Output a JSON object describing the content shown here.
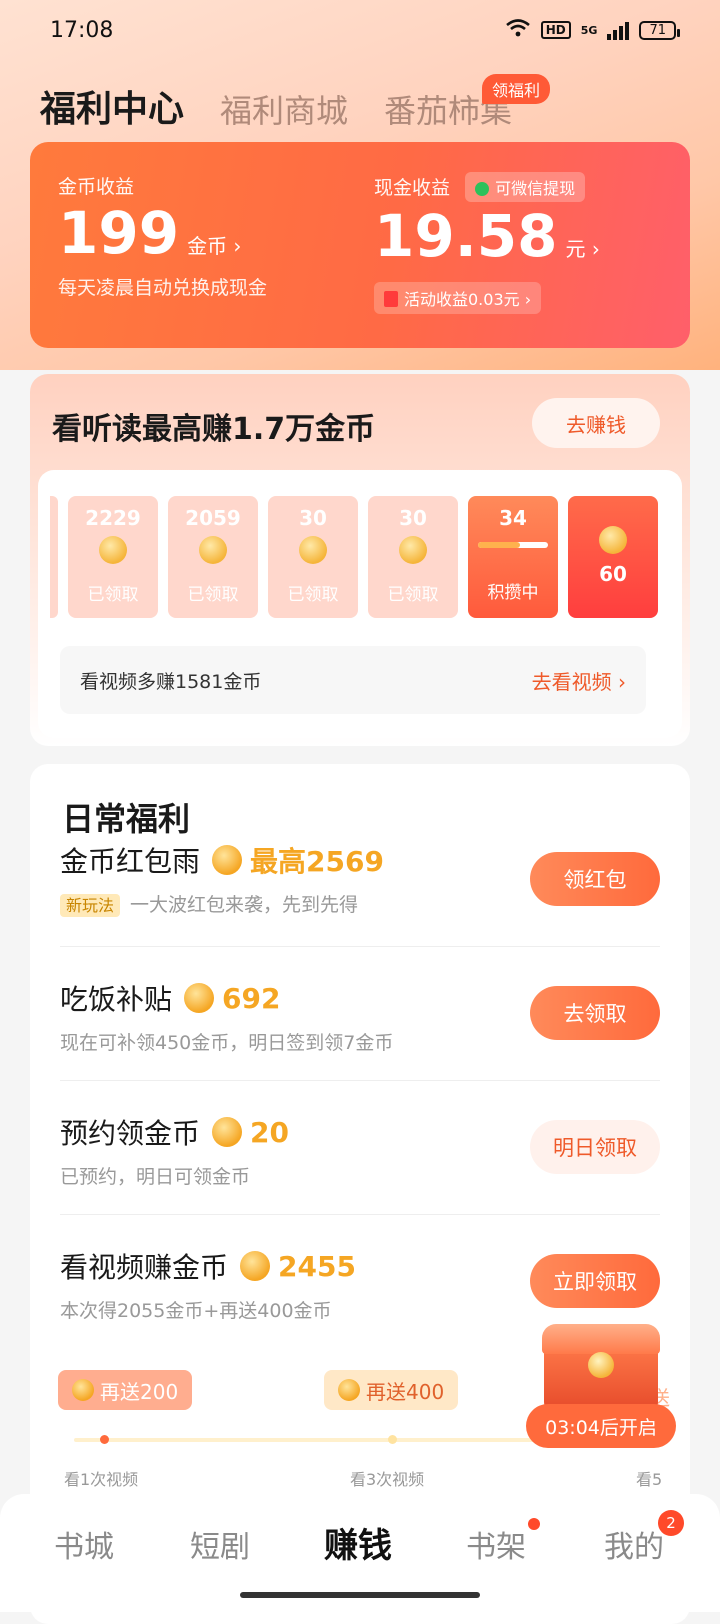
{
  "status": {
    "time": "17:08",
    "network": "5G",
    "battery": "71"
  },
  "tabs": [
    {
      "label": "福利中心"
    },
    {
      "label": "福利商城"
    },
    {
      "label": "番茄柿集"
    }
  ],
  "tab_badge": "领福利",
  "earnings": {
    "coin_label": "金币收益",
    "coin_value": "199",
    "coin_unit": "金币 ›",
    "coin_note": "每天凌晨自动兑换成现金",
    "cash_label": "现金收益",
    "cash_value": "19.58",
    "cash_unit": "元 ›",
    "wechat_pill": "可微信提现",
    "activity_pill": "活动收益0.03元 ›"
  },
  "watch": {
    "title": "看听读最高赚1.7万金币",
    "button": "去赚钱",
    "slots": [
      {
        "amount": "2229",
        "status": "已领取"
      },
      {
        "amount": "2059",
        "status": "已领取"
      },
      {
        "amount": "30",
        "status": "已领取"
      },
      {
        "amount": "30",
        "status": "已领取"
      },
      {
        "amount": "34",
        "status": "积攒中",
        "progress": 0.6
      },
      {
        "amount": "60"
      }
    ],
    "video_text": "看视频多赚1581金币",
    "video_link": "去看视频 ›"
  },
  "daily": {
    "title": "日常福利",
    "tasks": [
      {
        "name": "金币红包雨",
        "value": "最高2569",
        "tag": "新玩法",
        "desc": "一大波红包来袭，先到先得",
        "button": "领红包"
      },
      {
        "name": "吃饭补贴",
        "value": "692",
        "desc": "现在可补领450金币，明日签到领7金币",
        "button": "去领取"
      },
      {
        "name": "预约领金币",
        "value": "20",
        "desc": "已预约，明日可领金币",
        "button": "明日领取"
      },
      {
        "name": "看视频赚金币",
        "value": "2455",
        "desc": "本次得2055金币+再送400金币",
        "button": "立即领取"
      }
    ],
    "milestones": [
      {
        "chip": "再送200",
        "label": "看1次视频"
      },
      {
        "chip": "再送400",
        "label": "看3次视频"
      },
      {
        "chip": "送",
        "label": "看5"
      }
    ],
    "chest_timer": "03:04后开启"
  },
  "bottom_nav": [
    {
      "label": "书城"
    },
    {
      "label": "短剧"
    },
    {
      "label": "赚钱"
    },
    {
      "label": "书架"
    },
    {
      "label": "我的",
      "badge": "2"
    }
  ],
  "colors": {
    "accent": "#ff6a3c",
    "coin": "#f5a623"
  }
}
